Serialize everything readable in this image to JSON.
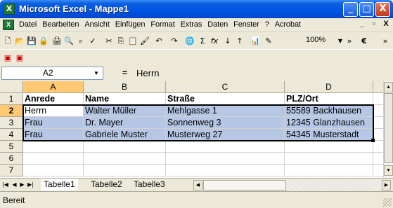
{
  "window": {
    "title": "Microsoft Excel - Mappe1",
    "app_icon_glyph": "X",
    "buttons": {
      "minimize": "_",
      "maximize": "□",
      "close": "X"
    }
  },
  "menu": {
    "items": [
      "Datei",
      "Bearbeiten",
      "Ansicht",
      "Einfügen",
      "Format",
      "Extras",
      "Daten",
      "Fenster",
      "?",
      "Acrobat"
    ],
    "doc_controls": {
      "minimize": "_",
      "restore": "▫",
      "close": "X"
    }
  },
  "toolbar": {
    "zoom": "100%",
    "currency_symbol": "€",
    "sum_symbol": "Σ",
    "fx_symbol": "fx"
  },
  "formula_bar": {
    "name_box": "A2",
    "equals": "=",
    "content": "Herrn"
  },
  "grid": {
    "corner": "",
    "columns": [
      "A",
      "B",
      "C",
      "D"
    ],
    "rows": [
      "1",
      "2",
      "3",
      "4",
      "5",
      "6",
      "7"
    ],
    "cells": [
      [
        "Anrede",
        "Name",
        "Straße",
        "PLZ/Ort"
      ],
      [
        "Herrn",
        "Walter Müller",
        "Mehlgasse 1",
        "55589 Backhausen"
      ],
      [
        "Frau",
        "Dr. Mayer",
        "Sonnenweg 3",
        "12345 Glanzhausen"
      ],
      [
        "Frau",
        "Gabriele Muster",
        "Musterweg 27",
        "54345 Musterstadt"
      ]
    ]
  },
  "sheets": {
    "tabs": [
      "Tabelle1",
      "Tabelle2",
      "Tabelle3"
    ],
    "active": "Tabelle1"
  },
  "status": {
    "text": "Bereit"
  }
}
